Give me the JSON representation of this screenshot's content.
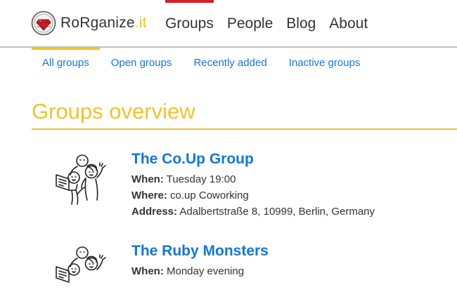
{
  "brand": {
    "name": "RoRganize",
    "tld": ".it"
  },
  "nav": [
    {
      "label": "Groups",
      "active": true
    },
    {
      "label": "People",
      "active": false
    },
    {
      "label": "Blog",
      "active": false
    },
    {
      "label": "About",
      "active": false
    }
  ],
  "tabs": [
    {
      "label": "All groups",
      "active": true
    },
    {
      "label": "Open groups",
      "active": false
    },
    {
      "label": "Recently added",
      "active": false
    },
    {
      "label": "Inactive groups",
      "active": false
    }
  ],
  "page_title": "Groups overview",
  "labels": {
    "when": "When:",
    "where": "Where:",
    "address": "Address:"
  },
  "groups": [
    {
      "name": "The Co.Up Group",
      "when": "Tuesday 19:00",
      "where": "co.up Coworking",
      "address": "Adalbertstraße 8, 10999, Berlin, Germany"
    },
    {
      "name": "The Ruby Monsters",
      "when": "Monday evening"
    }
  ],
  "colors": {
    "accent": "#f2c22d",
    "link": "#1576d2",
    "nav_active": "#d51f26",
    "logo_red": "#d51f26"
  }
}
